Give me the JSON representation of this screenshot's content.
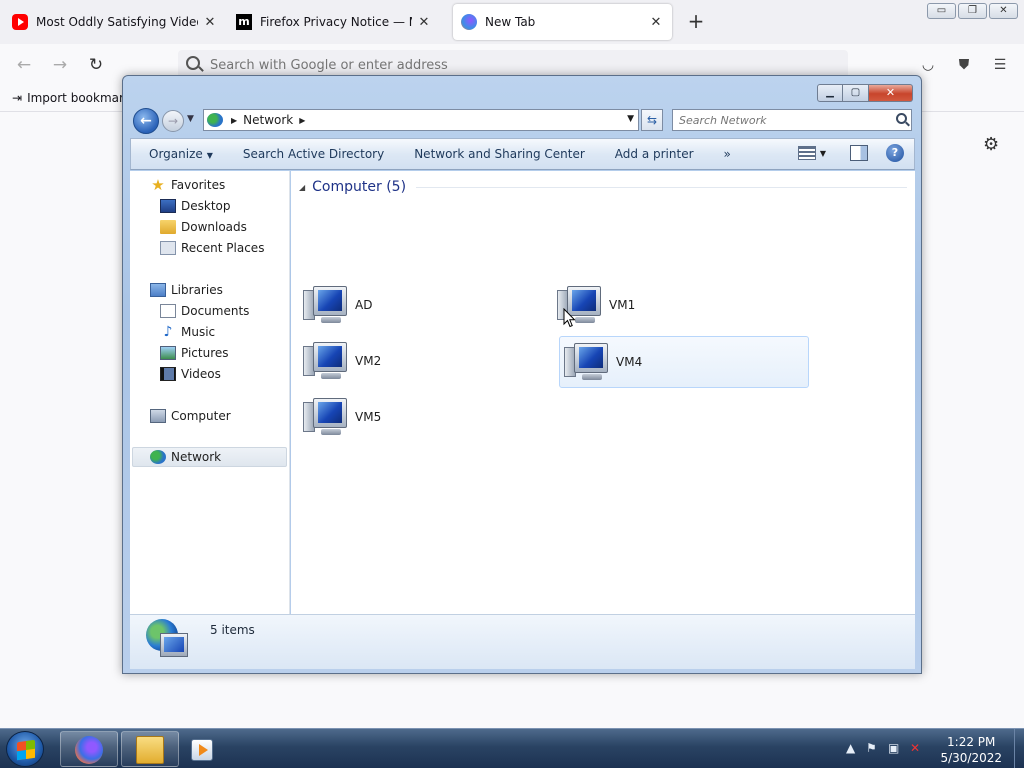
{
  "browser": {
    "tabs": [
      {
        "title": "Most Oddly Satisfying Video to",
        "favicon": "youtube-icon",
        "active": false
      },
      {
        "title": "Firefox Privacy Notice — Mozilla",
        "favicon": "mozilla-icon",
        "active": false
      },
      {
        "title": "New Tab",
        "favicon": "firefox-icon",
        "active": true
      }
    ],
    "new_tab_glyph": "+",
    "urlbar_placeholder": "Search with Google or enter address",
    "bookmarks": {
      "import_label": "Import bookmarks..."
    },
    "window_controls": {
      "min": "▭",
      "restore": "❐",
      "close": "✕"
    }
  },
  "explorer": {
    "address": {
      "location": "Network"
    },
    "search_placeholder": "Search Network",
    "toolbar": {
      "organize": "Organize",
      "search_ad": "Search Active Directory",
      "network_sharing": "Network and Sharing Center",
      "add_printer": "Add a printer",
      "more": "»",
      "help": "?"
    },
    "nav": {
      "favorites": "Favorites",
      "desktop": "Desktop",
      "downloads": "Downloads",
      "recent_places": "Recent Places",
      "libraries": "Libraries",
      "documents": "Documents",
      "music": "Music",
      "pictures": "Pictures",
      "videos": "Videos",
      "computer": "Computer",
      "network": "Network"
    },
    "group": {
      "header": "Computer (5)"
    },
    "computers": [
      "AD",
      "VM1",
      "VM2",
      "VM4",
      "VM5"
    ],
    "status": {
      "item_count": "5 items"
    }
  },
  "taskbar": {
    "clock_time": "1:22 PM",
    "clock_date": "5/30/2022"
  },
  "colors": {
    "explorer_frame": "#a9c4e6",
    "group_header": "#1e3287",
    "taskbar": "#2a4363"
  }
}
